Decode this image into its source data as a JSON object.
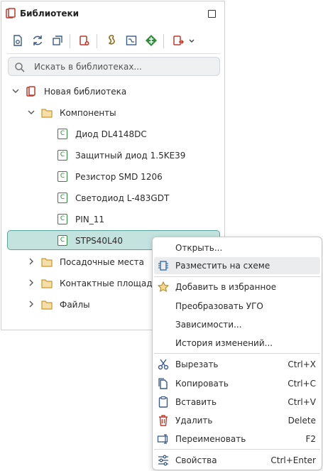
{
  "panel": {
    "title": "Библиотеки"
  },
  "search": {
    "placeholder": "Искать в библиотеках..."
  },
  "tree": {
    "root": "Новая библиотека",
    "components_folder": "Компоненты",
    "components": [
      "Диод DL4148DC",
      "Защитный диод 1.5KE39",
      "Резистор SMD 1206",
      "Светодиод L-483GDT",
      "PIN_11",
      "STPS40L40"
    ],
    "component_badge": "C",
    "folders": [
      "Посадочные места",
      "Контактные площадки",
      "Файлы"
    ]
  },
  "context_menu": {
    "items": [
      {
        "label": "Открыть...",
        "shortcut": ""
      },
      {
        "label": "Разместить на схеме",
        "shortcut": ""
      },
      {
        "label": "Добавить в избранное",
        "shortcut": ""
      },
      {
        "label": "Преобразовать УГО",
        "shortcut": ""
      },
      {
        "label": "Зависимости...",
        "shortcut": ""
      },
      {
        "label": "История изменений...",
        "shortcut": ""
      },
      {
        "label": "Вырезать",
        "shortcut": "Ctrl+X"
      },
      {
        "label": "Копировать",
        "shortcut": "Ctrl+C"
      },
      {
        "label": "Вставить",
        "shortcut": "Ctrl+V"
      },
      {
        "label": "Удалить",
        "shortcut": "Delete"
      },
      {
        "label": "Переименовать",
        "shortcut": "F2"
      },
      {
        "label": "Свойства",
        "shortcut": "Ctrl+Enter"
      }
    ]
  },
  "colors": {
    "accent": "#5aa39b",
    "selected_bg": "#c4e3df",
    "library_red": "#c0392b",
    "component_green": "#2e8b3a",
    "folder": "#d9a441"
  }
}
